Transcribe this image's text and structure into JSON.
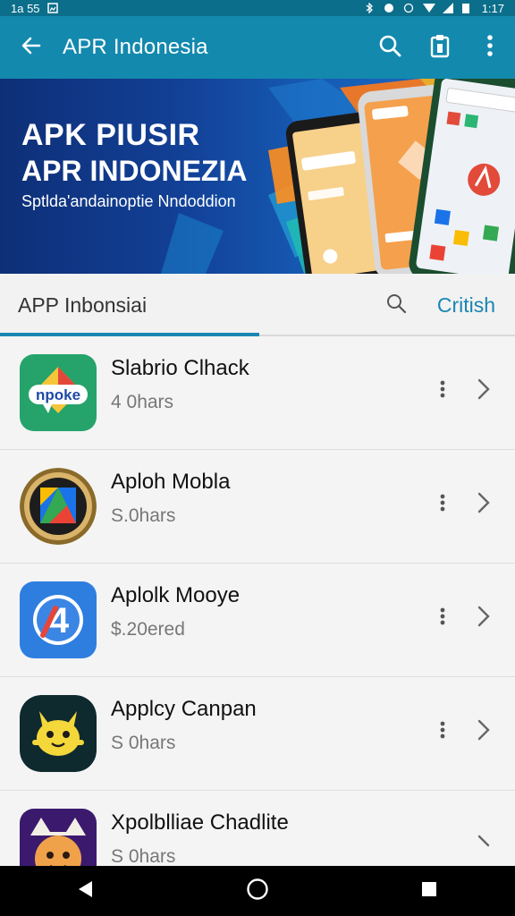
{
  "status_bar": {
    "time_left": "1a 55",
    "time_right": "1:17"
  },
  "app_bar": {
    "title": "APR Indonesia",
    "icons": [
      "back-arrow-icon",
      "search-icon",
      "clipboard-icon",
      "more-vert-icon"
    ]
  },
  "banner": {
    "line1": "APK PIUSIR",
    "line2": "APR INDONEZIA",
    "subline": "Sptlda'andainoptie Nndoddion"
  },
  "search": {
    "query": "APP Inbonsiai",
    "action": "Critish"
  },
  "apps": [
    {
      "name": "Slabrio Clhack",
      "meta": "4 0hars",
      "icon": "npoke-icon"
    },
    {
      "name": "Aploh Mobla",
      "meta": "S.0hars",
      "icon": "framed-play-icon"
    },
    {
      "name": "Aplolk Mooye",
      "meta": "$.20ered",
      "icon": "blue-4-icon"
    },
    {
      "name": "Applcy Canpan",
      "meta": "S 0hars",
      "icon": "yellow-creature-icon"
    },
    {
      "name": "Xpolblliae Chadlite",
      "meta": "S 0hars",
      "icon": "cartoon-face-icon"
    }
  ],
  "nav": {
    "icons": [
      "back-triangle-icon",
      "home-circle-icon",
      "recent-square-icon"
    ]
  },
  "colors": {
    "primary": "#1389ae",
    "accent": "#1a86b3",
    "status": "#0b6e8a"
  }
}
